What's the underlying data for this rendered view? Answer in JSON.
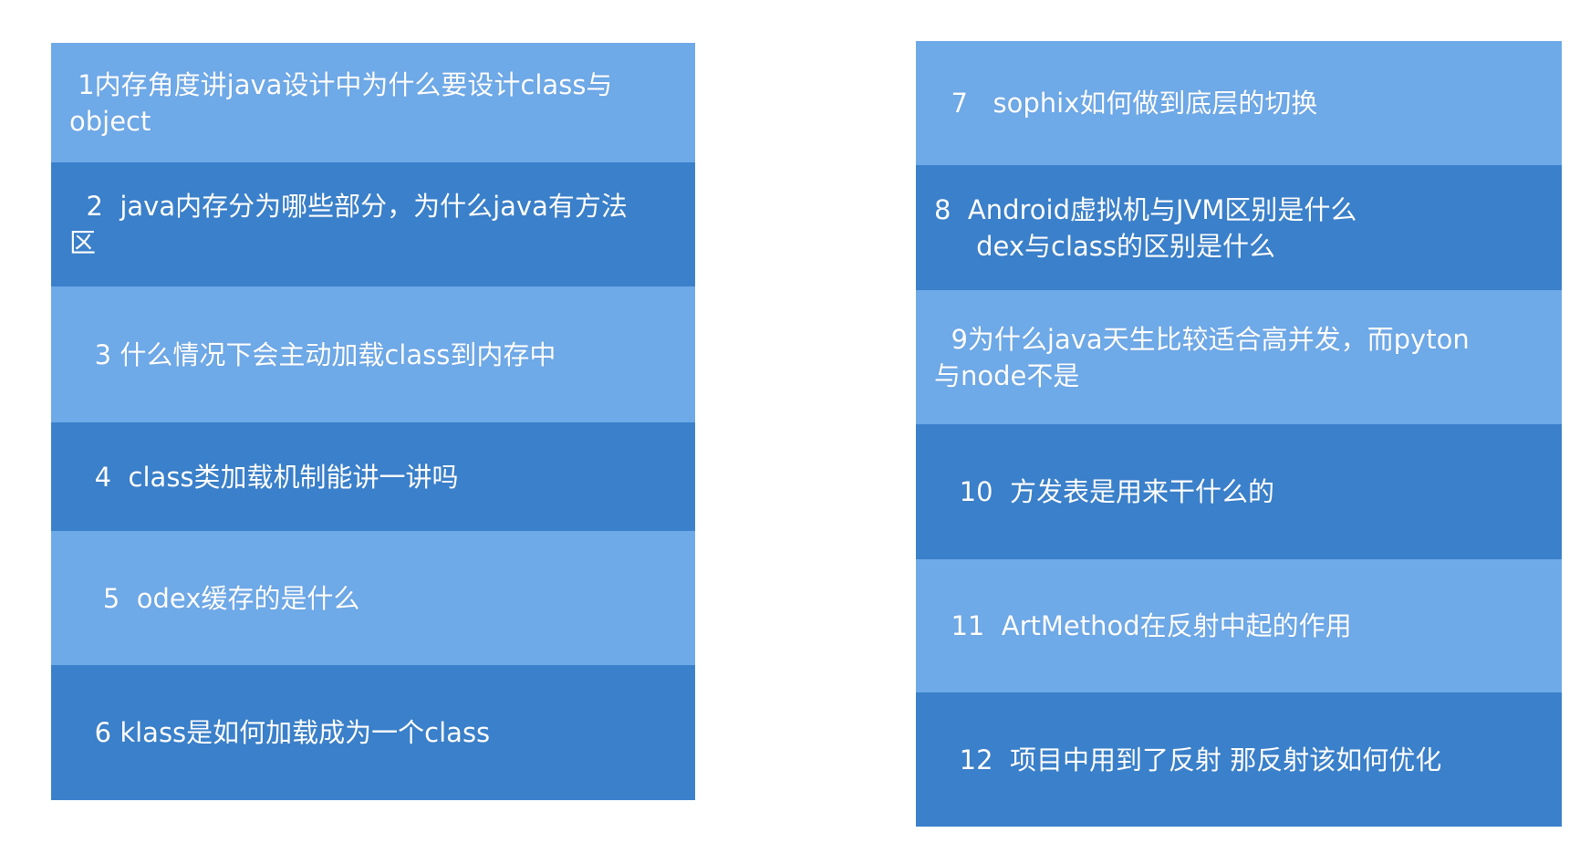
{
  "colors": {
    "light_cell": "#6ea9e8",
    "dark_cell": "#3a80cb",
    "text": "#ffffff",
    "background": "#ffffff"
  },
  "left_column": {
    "items": [
      {
        "text": " 1内存角度讲java设计中为什么要设计class与\nobject"
      },
      {
        "text": "  2  java内存分为哪些部分，为什么java有方法\n区"
      },
      {
        "text": "   3 什么情况下会主动加载class到内存中"
      },
      {
        "text": "   4  class类加载机制能讲一讲吗"
      },
      {
        "text": "    5  odex缓存的是什么"
      },
      {
        "text": "   6 klass是如何加载成为一个class"
      }
    ]
  },
  "right_column": {
    "items": [
      {
        "text": "  7   sophix如何做到底层的切换"
      },
      {
        "text": "8  Android虚拟机与JVM区别是什么\n     dex与class的区别是什么"
      },
      {
        "text": "  9为什么java天生比较适合高并发，而pyton\n与node不是"
      },
      {
        "text": "   10  方发表是用来干什么的"
      },
      {
        "text": "  11  ArtMethod在反射中起的作用"
      },
      {
        "text": "   12  项目中用到了反射 那反射该如何优化"
      }
    ]
  }
}
